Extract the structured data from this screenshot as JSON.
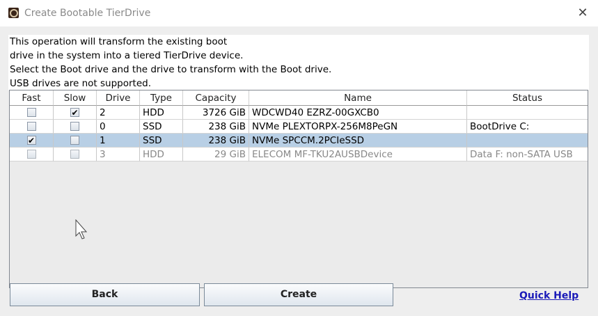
{
  "window": {
    "title": "Create Bootable TierDrive",
    "close_glyph": "✕"
  },
  "info": {
    "lines": [
      "This operation will transform the existing boot",
      "drive in the system into a tiered TierDrive device.",
      "Select the Boot drive and the drive to transform with the Boot drive.",
      "USB drives are not supported."
    ]
  },
  "table": {
    "headers": [
      "Fast",
      "Slow",
      "Drive",
      "Type",
      "Capacity",
      "Name",
      "Status"
    ],
    "rows": [
      {
        "fast": "",
        "slow": "✔",
        "drive": "2",
        "type": "HDD",
        "capacity": "3726 GiB",
        "name": "WDCWD40 EZRZ-00GXCB0",
        "status": ""
      },
      {
        "fast": "",
        "slow": "",
        "drive": "0",
        "type": "SSD",
        "capacity": "238 GiB",
        "name": "NVMe PLEXTORPX-256M8PeGN",
        "status": "BootDrive C:"
      },
      {
        "fast": "✔",
        "slow": "",
        "drive": "1",
        "type": "SSD",
        "capacity": "238 GiB",
        "name": "NVMe SPCCM.2PCIeSSD",
        "status": ""
      },
      {
        "fast": "",
        "slow": "",
        "drive": "3",
        "type": "HDD",
        "capacity": "29 GiB",
        "name": "ELECOM MF-TKU2AUSBDevice",
        "status": "Data F:   non-SATA  USB"
      }
    ]
  },
  "buttons": {
    "back": "Back",
    "create": "Create",
    "quick_help": "Quick Help"
  }
}
